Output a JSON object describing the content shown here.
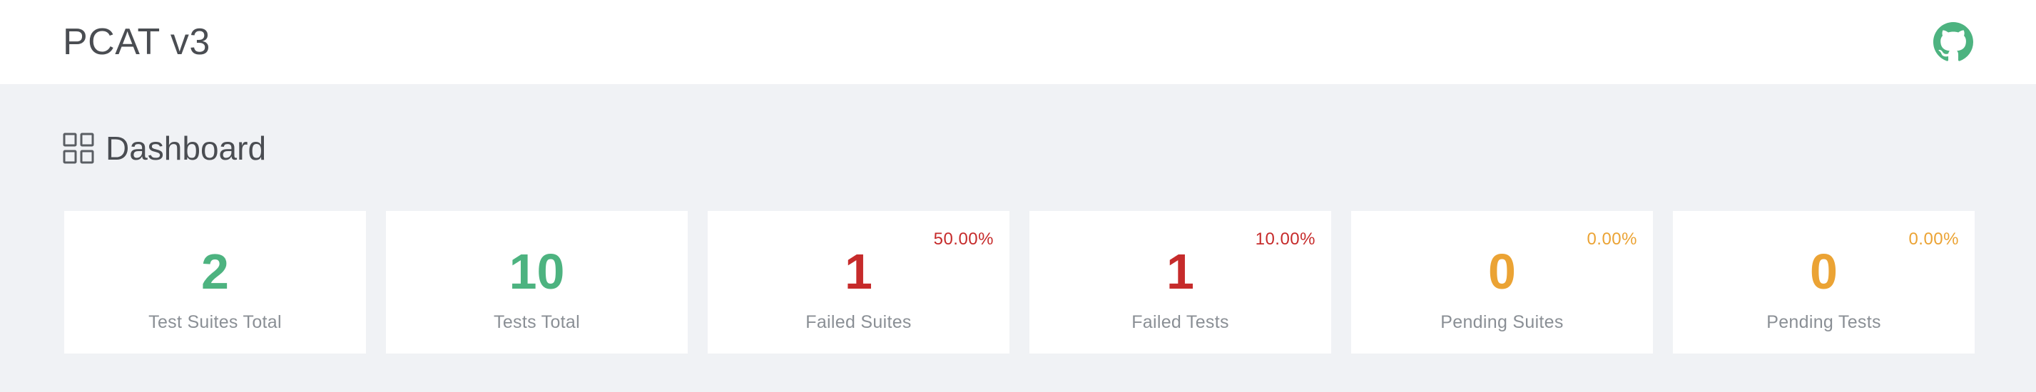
{
  "header": {
    "title": "PCAT v3",
    "github_icon": "github-icon",
    "github_color": "#4db380"
  },
  "dashboard": {
    "title": "Dashboard",
    "icon": "grid-icon"
  },
  "colors": {
    "success": "#4db380",
    "failed": "#c62b2b",
    "pending": "#eba334"
  },
  "cards": [
    {
      "value": "2",
      "label": "Test Suites Total",
      "percent": ""
    },
    {
      "value": "10",
      "label": "Tests Total",
      "percent": ""
    },
    {
      "value": "1",
      "label": "Failed Suites",
      "percent": "50.00%"
    },
    {
      "value": "1",
      "label": "Failed Tests",
      "percent": "10.00%"
    },
    {
      "value": "0",
      "label": "Pending Suites",
      "percent": "0.00%"
    },
    {
      "value": "0",
      "label": "Pending Tests",
      "percent": "0.00%"
    }
  ]
}
